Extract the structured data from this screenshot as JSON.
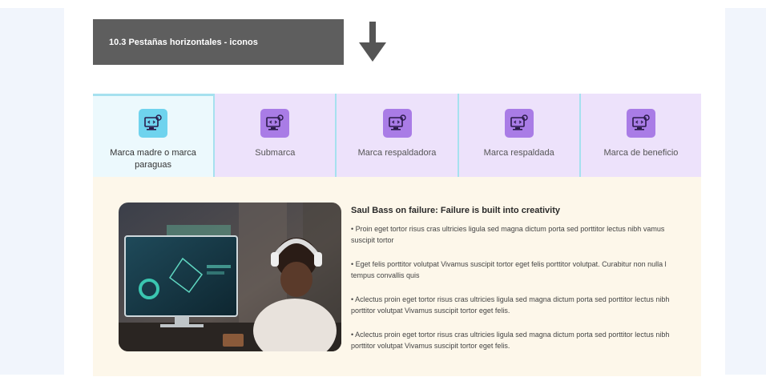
{
  "banner": {
    "title": "10.3 Pestañas horizontales - iconos"
  },
  "tabs": [
    {
      "label": "Marca madre o marca paraguas",
      "icon": "monitor-code-icon",
      "active": true
    },
    {
      "label": "Submarca",
      "icon": "monitor-code-icon",
      "active": false
    },
    {
      "label": "Marca respaldadora",
      "icon": "monitor-code-icon",
      "active": false
    },
    {
      "label": "Marca respaldada",
      "icon": "monitor-code-icon",
      "active": false
    },
    {
      "label": "Marca de beneficio",
      "icon": "monitor-code-icon",
      "active": false
    }
  ],
  "content": {
    "title": "Saul Bass on failure: Failure is built into creativity",
    "bullets": [
      "• Proin eget tortor risus cras ultricies ligula sed magna dictum porta sed porttitor lectus nibh vamus suscipit tortor",
      "• Eget felis porttitor volutpat Vivamus suscipit tortor eget felis porttitor volutpat. Curabitur non nulla l tempus convallis quis",
      "• Aclectus proin eget tortor risus cras ultricies ligula sed magna dictum porta sed porttitor lectus nibh porttitor volutpat Vivamus suscipit tortor eget felis.",
      "• Aclectus proin eget tortor risus cras ultricies ligula sed magna dictum porta sed porttitor lectus nibh porttitor volutpat Vivamus suscipit tortor eget felis."
    ]
  },
  "colors": {
    "banner_bg": "#5e5e5e",
    "tab_bg": "#ede2fb",
    "tab_active_bg": "#ecf9fd",
    "tab_divider": "#a6e1ef",
    "icon_bg": "#a97ce6",
    "icon_active_bg": "#6fd3ee",
    "panel_bg": "#fdf7ea",
    "side_bg": "#f1f5fc"
  }
}
